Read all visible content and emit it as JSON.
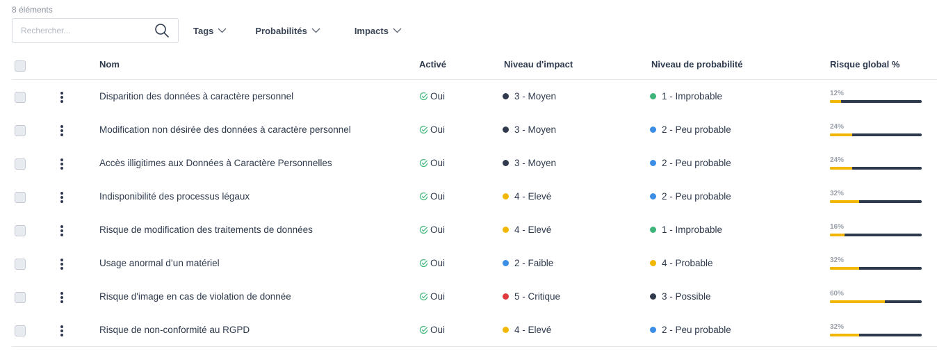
{
  "count_label": "8 éléments",
  "search": {
    "placeholder": "Rechercher..."
  },
  "filters": [
    "Tags",
    "Probabilités",
    "Impacts"
  ],
  "columns": {
    "nom": "Nom",
    "active": "Activé",
    "impact": "Niveau d'impact",
    "probability": "Niveau de probabilité",
    "risk": "Risque global %"
  },
  "colors": {
    "dark": "#2f3b4c",
    "yellow": "#f2b705",
    "blue": "#3a8ee6",
    "green": "#3fb57a",
    "red": "#e0393e",
    "check": "#3fb57a"
  },
  "rows": [
    {
      "name": "Disparition des données à caractère personnel",
      "active": "Oui",
      "impact": "3 - Moyen",
      "impact_color": "dark",
      "probability": "1 - Improbable",
      "probability_color": "green",
      "risk": 12,
      "risk_label": "12%"
    },
    {
      "name": "Modification non désirée des données à caractère personnel",
      "active": "Oui",
      "impact": "3 - Moyen",
      "impact_color": "dark",
      "probability": "2 - Peu probable",
      "probability_color": "blue",
      "risk": 24,
      "risk_label": "24%"
    },
    {
      "name": "Accès illigitimes aux Données à Caractère Personnelles",
      "active": "Oui",
      "impact": "3 - Moyen",
      "impact_color": "dark",
      "probability": "2 - Peu probable",
      "probability_color": "blue",
      "risk": 24,
      "risk_label": "24%"
    },
    {
      "name": "Indisponibilité des processus légaux",
      "active": "Oui",
      "impact": "4 - Elevé",
      "impact_color": "yellow",
      "probability": "2 - Peu probable",
      "probability_color": "blue",
      "risk": 32,
      "risk_label": "32%"
    },
    {
      "name": "Risque de modification des traitements de données",
      "active": "Oui",
      "impact": "4 - Elevé",
      "impact_color": "yellow",
      "probability": "1 - Improbable",
      "probability_color": "green",
      "risk": 16,
      "risk_label": "16%"
    },
    {
      "name": "Usage anormal d’un matériel",
      "active": "Oui",
      "impact": "2 - Faible",
      "impact_color": "blue",
      "probability": "4 - Probable",
      "probability_color": "yellow",
      "risk": 32,
      "risk_label": "32%"
    },
    {
      "name": "Risque d'image en cas de violation de donnée",
      "active": "Oui",
      "impact": "5 - Critique",
      "impact_color": "red",
      "probability": "3 - Possible",
      "probability_color": "dark",
      "risk": 60,
      "risk_label": "60%"
    },
    {
      "name": "Risque de non-conformité au RGPD",
      "active": "Oui",
      "impact": "4 - Elevé",
      "impact_color": "yellow",
      "probability": "2 - Peu probable",
      "probability_color": "blue",
      "risk": 32,
      "risk_label": "32%"
    }
  ]
}
